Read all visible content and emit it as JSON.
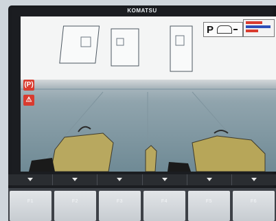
{
  "brand": "KOMATSU",
  "top_right": {
    "park_label": "P"
  },
  "side_buttons": [
    {
      "label": "(P)",
      "icon": "parking-brake-icon"
    },
    {
      "label": "⚠",
      "icon": "operator-warning-icon"
    }
  ],
  "camera_label": {
    "icon": "camera-view-icon"
  },
  "function_keys": [
    {
      "label": "F1"
    },
    {
      "label": "F2"
    },
    {
      "label": "F3"
    },
    {
      "label": "F4"
    },
    {
      "label": "F5"
    },
    {
      "label": "F6"
    }
  ],
  "colors": {
    "warning_red": "#d93b2f",
    "camera_label_blue": "#7fb9d8"
  }
}
